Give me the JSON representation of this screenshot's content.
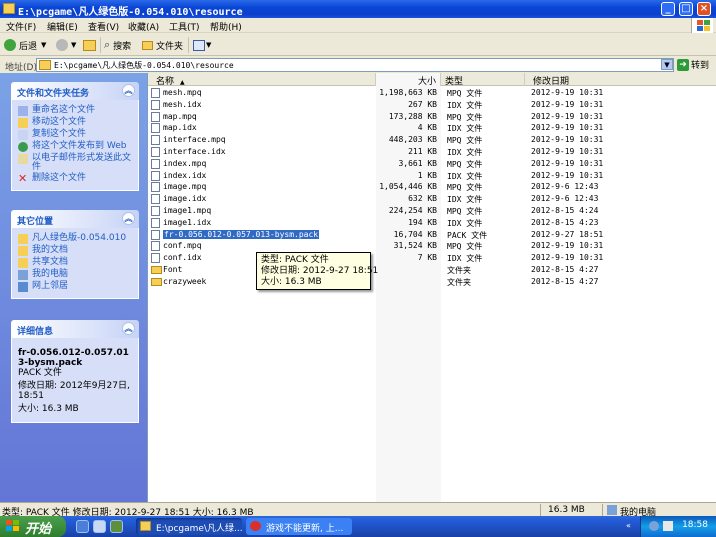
{
  "window": {
    "title": "E:\\pcgame\\凡人绿色版-0.054.010\\resource"
  },
  "menu": [
    "文件(F)",
    "编辑(E)",
    "查看(V)",
    "收藏(A)",
    "工具(T)",
    "帮助(H)"
  ],
  "toolbar": {
    "back": "后退",
    "search": "搜索",
    "folders": "文件夹"
  },
  "address": {
    "label": "地址(D)",
    "value": "E:\\pcgame\\凡人绿色版-0.054.010\\resource",
    "go": "转到"
  },
  "tasks": {
    "file_tasks": {
      "title": "文件和文件夹任务",
      "items": [
        "重命名这个文件",
        "移动这个文件",
        "复制这个文件",
        "将这个文件发布到 Web",
        "以电子邮件形式发送此文件",
        "删除这个文件"
      ]
    },
    "other_places": {
      "title": "其它位置",
      "items": [
        "凡人绿色版-0.054.010",
        "我的文档",
        "共享文档",
        "我的电脑",
        "网上邻居"
      ]
    },
    "details": {
      "title": "详细信息",
      "name": "fr-0.056.012-0.057.013-bysm.pack",
      "type": "PACK 文件",
      "modified": "修改日期: 2012年9月27日, 18:51",
      "size": "大小: 16.3 MB"
    }
  },
  "columns": {
    "name": "名称",
    "size": "大小",
    "type": "类型",
    "modified": "修改日期"
  },
  "files": [
    {
      "name": "mesh.mpq",
      "size": "1,198,663 KB",
      "type": "MPQ 文件",
      "date": "2012-9-19 10:31"
    },
    {
      "name": "mesh.idx",
      "size": "267 KB",
      "type": "IDX 文件",
      "date": "2012-9-19 10:31"
    },
    {
      "name": "map.mpq",
      "size": "173,288 KB",
      "type": "MPQ 文件",
      "date": "2012-9-19 10:31"
    },
    {
      "name": "map.idx",
      "size": "4 KB",
      "type": "IDX 文件",
      "date": "2012-9-19 10:31"
    },
    {
      "name": "interface.mpq",
      "size": "448,203 KB",
      "type": "MPQ 文件",
      "date": "2012-9-19 10:31"
    },
    {
      "name": "interface.idx",
      "size": "211 KB",
      "type": "IDX 文件",
      "date": "2012-9-19 10:31"
    },
    {
      "name": "index.mpq",
      "size": "3,661 KB",
      "type": "MPQ 文件",
      "date": "2012-9-19 10:31"
    },
    {
      "name": "index.idx",
      "size": "1 KB",
      "type": "IDX 文件",
      "date": "2012-9-19 10:31"
    },
    {
      "name": "image.mpq",
      "size": "1,054,446 KB",
      "type": "MPQ 文件",
      "date": "2012-9-6 12:43"
    },
    {
      "name": "image.idx",
      "size": "632 KB",
      "type": "IDX 文件",
      "date": "2012-9-6 12:43"
    },
    {
      "name": "image1.mpq",
      "size": "224,254 KB",
      "type": "MPQ 文件",
      "date": "2012-8-15 4:24"
    },
    {
      "name": "image1.idx",
      "size": "194 KB",
      "type": "IDX 文件",
      "date": "2012-8-15 4:23"
    },
    {
      "name": "fr-0.056.012-0.057.013-bysm.pack",
      "size": "16,704 KB",
      "type": "PACK 文件",
      "date": "2012-9-27 18:51",
      "selected": true
    },
    {
      "name": "conf.mpq",
      "size": "31,524 KB",
      "type": "MPQ 文件",
      "date": "2012-9-19 10:31"
    },
    {
      "name": "conf.idx",
      "size": "7 KB",
      "type": "IDX 文件",
      "date": "2012-9-19 10:31"
    },
    {
      "name": "Font",
      "size": "",
      "type": "文件夹",
      "date": "2012-8-15 4:27",
      "folder": true
    },
    {
      "name": "crazyweek",
      "size": "",
      "type": "文件夹",
      "date": "2012-8-15 4:27",
      "folder": true
    }
  ],
  "tooltip": {
    "type": "类型: PACK 文件",
    "modified": "修改日期: 2012-9-27 18:51",
    "size": "大小: 16.3 MB"
  },
  "status": {
    "left": "类型: PACK 文件 修改日期: 2012-9-27 18:51 大小: 16.3 MB",
    "size": "16.3 MB",
    "location": "我的电脑"
  },
  "taskbar": {
    "start": "开始",
    "tasks": [
      "E:\\pcgame\\凡人绿...",
      "游戏不能更新, 上..."
    ],
    "clock": "18:58"
  },
  "colors": {
    "title_blue": "#0a47d6",
    "task_link": "#215dc6",
    "selection": "#316ac5",
    "start_green": "#3c8f3c"
  }
}
